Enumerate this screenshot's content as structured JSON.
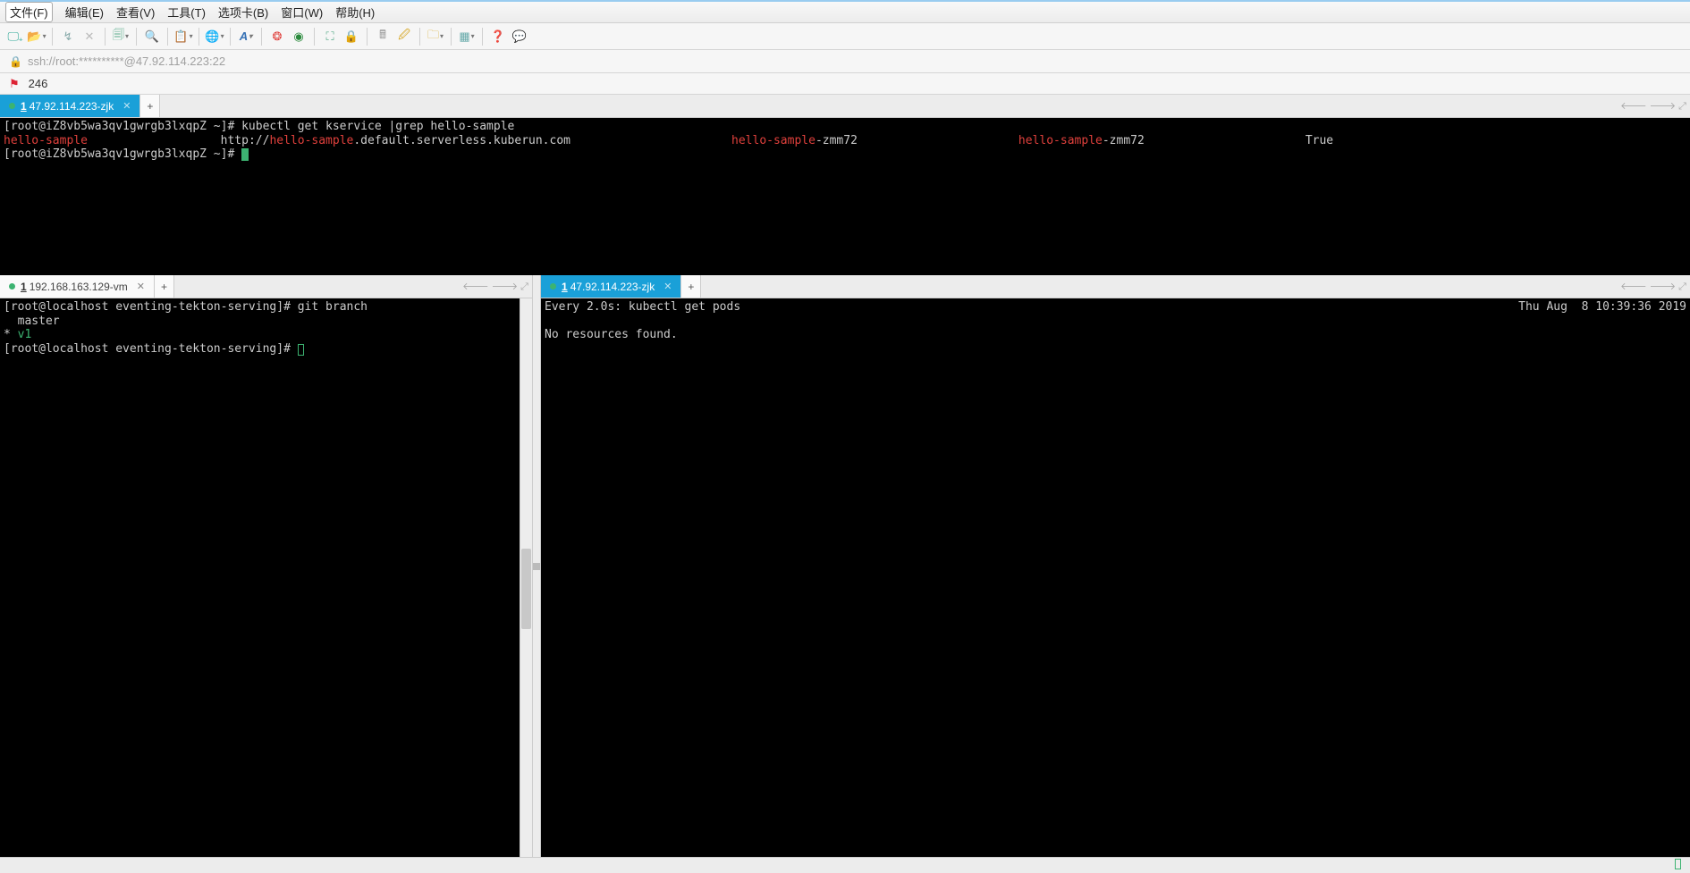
{
  "menu": {
    "file": "文件(F)",
    "edit": "编辑(E)",
    "view": "查看(V)",
    "tools": "工具(T)",
    "tabs": "选项卡(B)",
    "window": "窗口(W)",
    "help": "帮助(H)"
  },
  "address": "ssh://root:**********@47.92.114.223:22",
  "bookmarks": {
    "item1": "246"
  },
  "toolbar_icons": {
    "new": "⎘",
    "open": "📂",
    "link1": "🔗",
    "link2": "🔗",
    "copy": "📋",
    "search": "🔍",
    "paste": "📋",
    "globe": "🌐",
    "font": "A",
    "spiral": "❂",
    "target": "◉",
    "expand": "⛶",
    "lock": "🔒",
    "calc": "🖩",
    "brush": "🖌",
    "folder": "📁",
    "grid": "▦",
    "help": "❓",
    "chat": "💬"
  },
  "top_pane": {
    "tab": {
      "num": "1",
      "label": "47.92.114.223-zjk"
    },
    "prompt1": "[root@iZ8vb5wa3qv1gwrgb3lxqpZ ~]#",
    "cmd1": "kubectl get kservice |grep hello-sample",
    "col1": "hello-sample",
    "url_pre": "http://",
    "url_host": "hello-sample",
    "url_rest": ".default.serverless.kuberun.com",
    "col3a": "hello-sample",
    "col3b": "-zmm72",
    "col4a": "hello-sample",
    "col4b": "-zmm72",
    "col5": "True",
    "prompt2": "[root@iZ8vb5wa3qv1gwrgb3lxqpZ ~]#"
  },
  "bl_pane": {
    "tab": {
      "num": "1",
      "label": "192.168.163.129-vm"
    },
    "line1_prompt": "[root@localhost eventing-tekton-serving]#",
    "line1_cmd": "git branch",
    "line2": "  master",
    "line3": "* ",
    "line3_branch": "v1",
    "line4_prompt": "[root@localhost eventing-tekton-serving]#"
  },
  "br_pane": {
    "tab": {
      "num": "1",
      "label": "47.92.114.223-zjk"
    },
    "header_left": "Every 2.0s: kubectl get pods",
    "header_right": "Thu Aug  8 10:39:36 2019",
    "body": "No resources found."
  }
}
